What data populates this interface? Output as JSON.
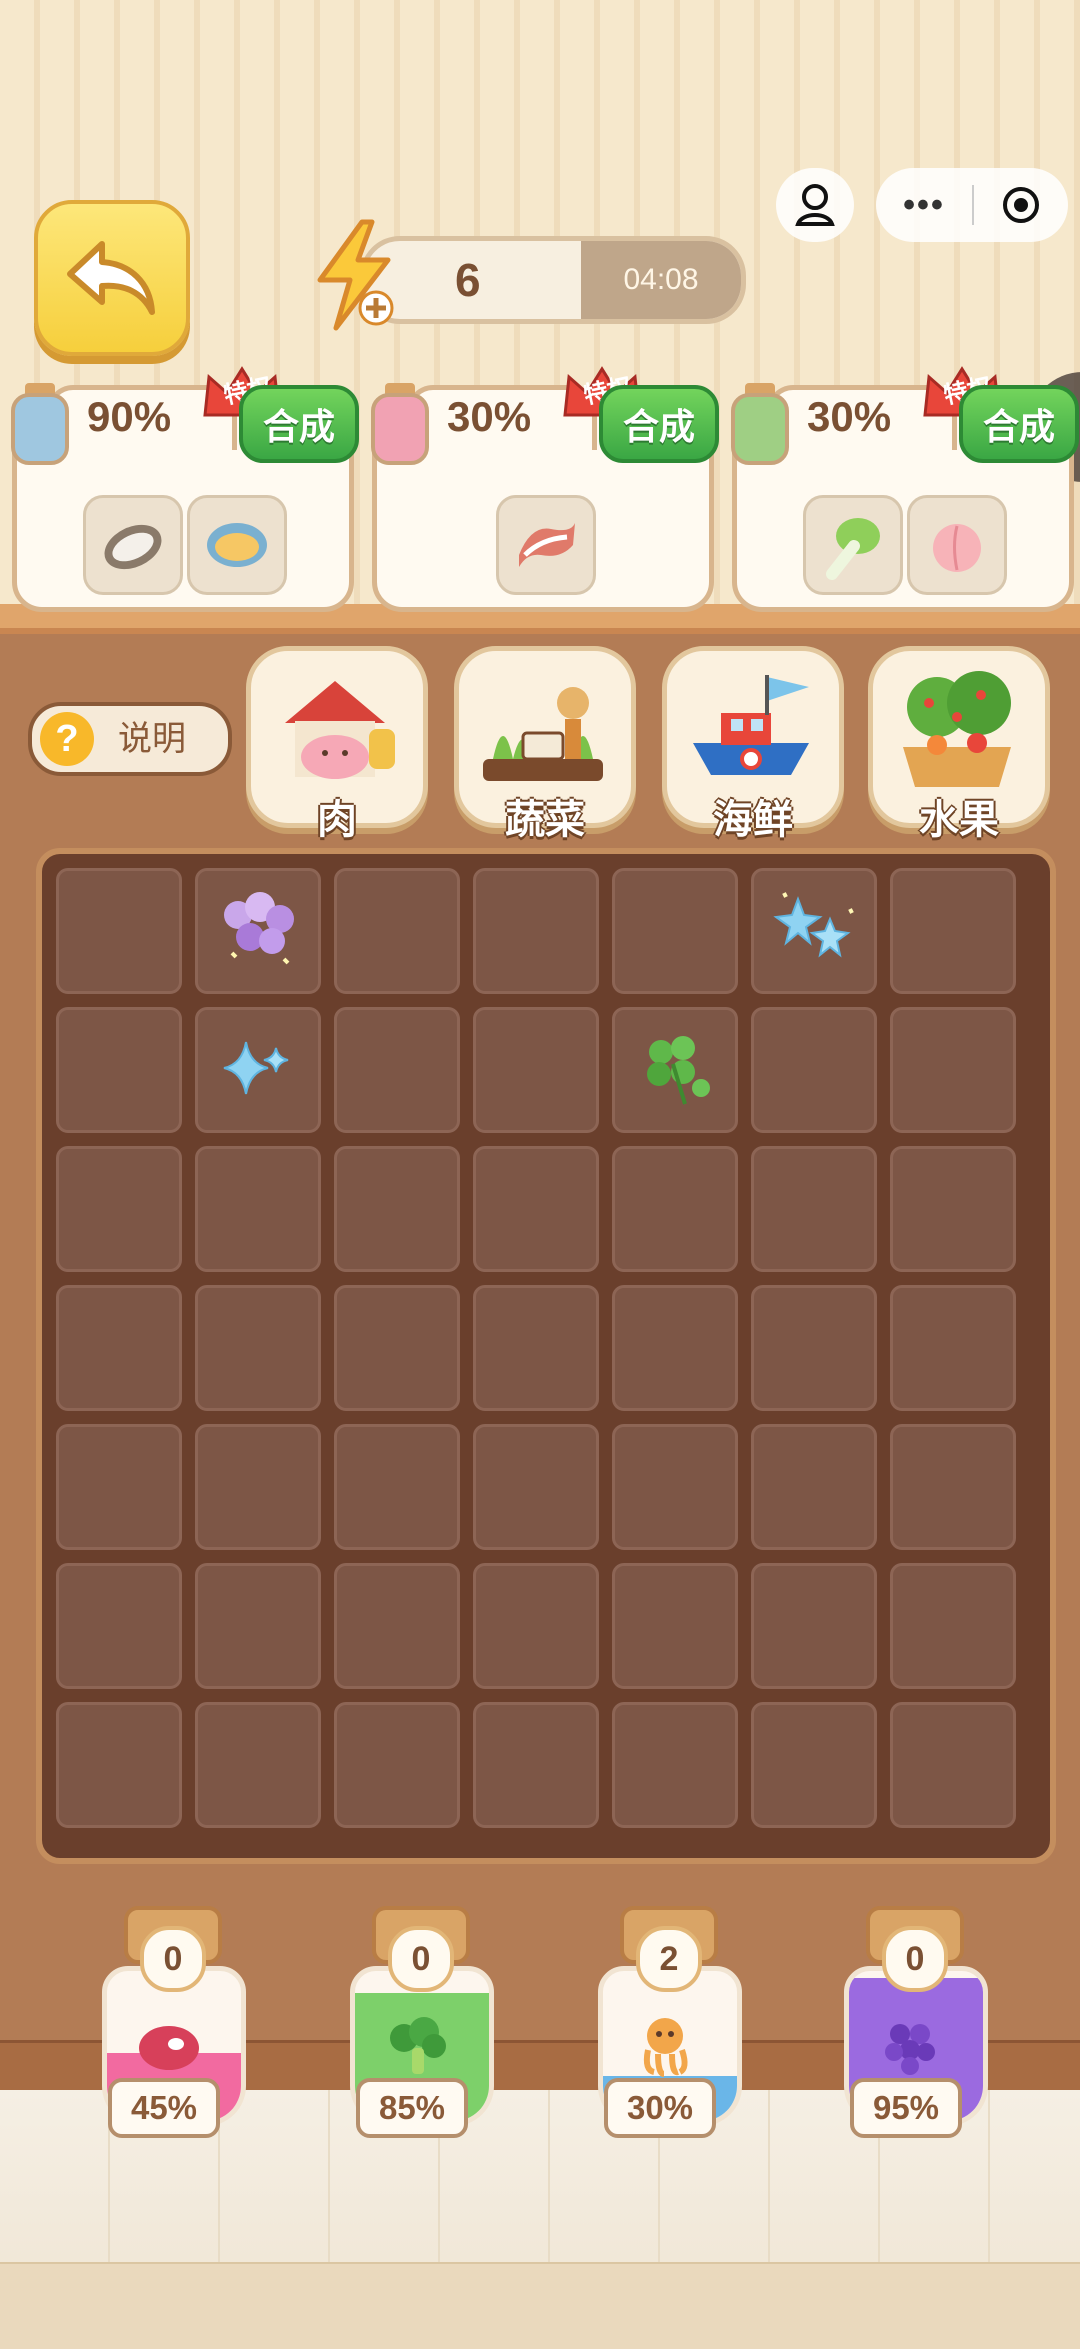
{
  "topbar": {
    "energy_count": "6",
    "energy_timer": "04:08"
  },
  "recipes": [
    {
      "percent": "90%",
      "merge_label": "合成",
      "privilege_label": "特权",
      "items": [
        "oyster",
        "clam"
      ]
    },
    {
      "percent": "30%",
      "merge_label": "合成",
      "privilege_label": "特权",
      "items": [
        "bacon"
      ]
    },
    {
      "percent": "30%",
      "merge_label": "合成",
      "privilege_label": "特权",
      "items": [
        "bok-choy",
        "peach"
      ]
    }
  ],
  "help": {
    "label": "说明"
  },
  "categories": [
    {
      "label": "肉",
      "icon": "pig-barn-icon"
    },
    {
      "label": "蔬菜",
      "icon": "scarecrow-garden-icon"
    },
    {
      "label": "海鲜",
      "icon": "fishing-boat-icon"
    },
    {
      "label": "水果",
      "icon": "fruit-tree-basket-icon"
    }
  ],
  "board": {
    "rows": 7,
    "cols": 7,
    "items": [
      {
        "row": 0,
        "col": 1,
        "icon": "purple-flower-cluster-icon"
      },
      {
        "row": 0,
        "col": 5,
        "icon": "blue-star-cluster-icon"
      },
      {
        "row": 1,
        "col": 1,
        "icon": "blue-sparkle-icon"
      },
      {
        "row": 1,
        "col": 4,
        "icon": "four-leaf-clover-icon"
      }
    ]
  },
  "jars": [
    {
      "count": "0",
      "percent": "45%",
      "fill_level": 0.45,
      "color": "#f26aa0",
      "icon": "steak-icon"
    },
    {
      "count": "0",
      "percent": "85%",
      "fill_level": 0.85,
      "color": "#7dd06a",
      "icon": "broccoli-icon"
    },
    {
      "count": "2",
      "percent": "30%",
      "fill_level": 0.3,
      "color": "#6ab6e8",
      "icon": "octopus-icon"
    },
    {
      "count": "0",
      "percent": "95%",
      "fill_level": 0.95,
      "color": "#9b6ae0",
      "icon": "grapes-icon"
    }
  ]
}
